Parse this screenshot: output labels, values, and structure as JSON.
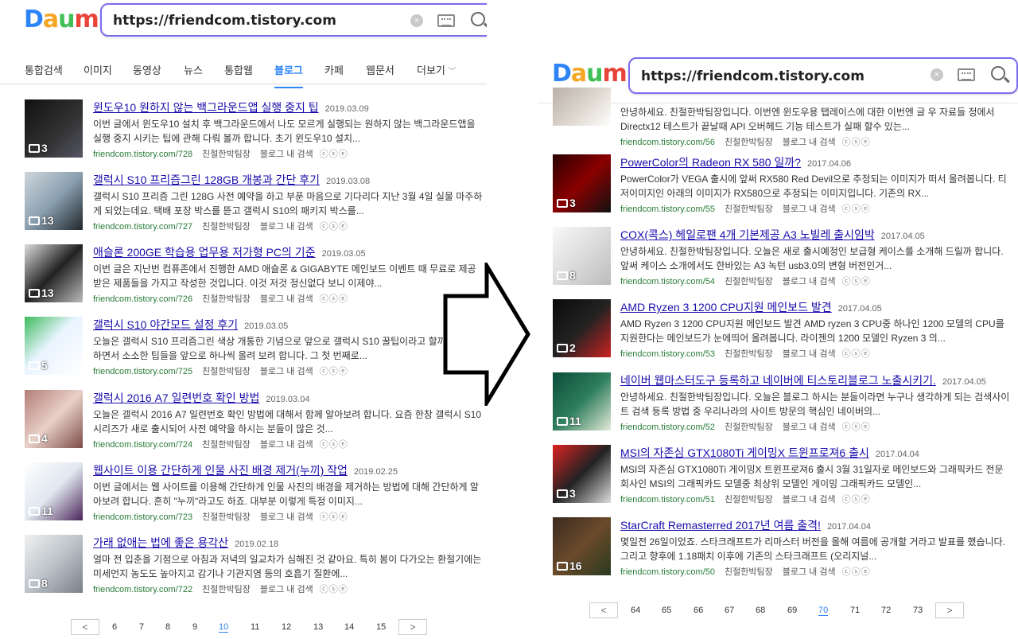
{
  "left": {
    "logo": "Daum",
    "search_url": "https://friendcom.tistory.com",
    "tabs": [
      "통합검색",
      "이미지",
      "동영상",
      "뉴스",
      "통합웹",
      "블로그",
      "카페",
      "웹문서",
      "더보기"
    ],
    "results": [
      {
        "title": "윈도우10 원하지 않는 백그라운드앱 실행 중지 팁",
        "date": "2019.03.09",
        "desc": "이번 글에서 윈도우10 설치 후 백그라운드에서 나도 모르게 실행되는 원하지 않는 백그라운드앱을 실행 중지 시키는 팁에 관해 다뤄 볼까 합니다. 초기 윈도우10 설치...",
        "url": "friendcom.tistory.com/728",
        "author": "친절한박팀장",
        "count": "3"
      },
      {
        "title": "갤럭시 S10 프리즘그린 128GB 개봉과 간단 후기",
        "date": "2019.03.08",
        "desc": "갤럭시 S10 프리즘 그린 128G 사전 예약을 하고 부푼 마음으로 기다리다 지난 3월 4일 실물 마주하게 되었는데요. 택배 포장 박스를 뜯고 갤럭시 S10의 패키지 박스를...",
        "url": "friendcom.tistory.com/727",
        "author": "친절한박팀장",
        "count": "13"
      },
      {
        "title": "애슬론 200GE 학습용 업무용 저가형 PC의 기준",
        "date": "2019.03.05",
        "desc": "이번 글은 지난번 컴퓨존에서 진행한 AMD 애슬론 & GIGABYTE 메인보드 이벤트 때 무료로 제공받은 제품들을 가지고 작성한 것입니다. 이것 저것 정신없다 보니 이제야...",
        "url": "friendcom.tistory.com/726",
        "author": "친절한박팀장",
        "count": "13"
      },
      {
        "title": "갤럭시 S10 야간모드 설정 후기",
        "date": "2019.03.05",
        "desc": "오늘은 갤럭시 S10 프리즘그린 색상 개통한 기념으로 앞으로 갤럭시 S10 꿀팁이라고 할까요? 사용하면서 소소한 팁들을 앞으로 하나씩 올려 보려 합니다. 그 첫 번째로...",
        "url": "friendcom.tistory.com/725",
        "author": "친절한박팀장",
        "count": "5"
      },
      {
        "title": "갤럭시 2016 A7 일련번호 확인 방법",
        "date": "2019.03.04",
        "desc": "오늘은 갤럭시 2016 A7 일련번호 확인 방법에 대해서 함께 알아보려 합니다. 요즘 한창 갤럭시 S10 시리즈가 새로 출시되어 사전 예약을 하시는 분들이 많은 것...",
        "url": "friendcom.tistory.com/724",
        "author": "친절한박팀장",
        "count": "4"
      },
      {
        "title": "웹사이트 이용 간단하게 인물 사진 배경 제거(누끼) 작업",
        "date": "2019.02.25",
        "desc": "이번 글에서는 웹 사이트를 이용해 간단하게 인물 사진의 배경을 제거하는 방법에 대해 간단하게 알아보려 합니다. 흔히 \"누끼\"라고도 하죠. 대부분 이렇게 특정 이미지...",
        "url": "friendcom.tistory.com/723",
        "author": "친절한박팀장",
        "count": "11"
      },
      {
        "title": "가래 없애는 법에 좋은 용각산",
        "date": "2019.02.18",
        "desc": "얼마 전 입춘을 기점으로 아침과 저녁의 일교차가 심해진 것 같아요. 특히 봄이 다가오는 환절기에는 미세먼지 농도도 높아지고 감기나 기관지염 등의 호흡기 질환에...",
        "url": "friendcom.tistory.com/722",
        "author": "친절한박팀장",
        "count": "8"
      }
    ],
    "meta_label": "블로그 내 검색",
    "pages": [
      "6",
      "7",
      "8",
      "9",
      "10",
      "11",
      "12",
      "13",
      "14",
      "15"
    ],
    "current_page": "10",
    "prev": "<",
    "next": ">"
  },
  "right": {
    "logo": "Daum",
    "search_url": "https://friendcom.tistory.com",
    "partial": {
      "desc": "안녕하세요. 친절한박팀장입니다. 이번엔 윈도우용 탭레이스에 대한 이번엔 글 우 자료들 정에서 Directx12 테스트가 끝날때 API 오버헤드 기능 테스트가 실패 할수 있는...",
      "url": "friendcom.tistory.com/56",
      "author": "친절한박팀장"
    },
    "results": [
      {
        "title": "PowerColor의 Radeon RX 580 일까?",
        "date": "2017.04.06",
        "desc": "PowerColor가 VEGA 출시에 앞써 RX580 Red Devil으로 추정되는 이미지가 떠서 올려봅니다. 티저이미지인 아래의 이미지가 RX580으로 추정되는 이미지입니다. 기존의 RX...",
        "url": "friendcom.tistory.com/55",
        "author": "친절한박팀장",
        "count": "3"
      },
      {
        "title": "COX(콕스) 헤일로팬 4개 기본제공 A3 노빌레 출시임박",
        "date": "2017.04.05",
        "desc": "안녕하세요. 친절한박팀장입니다. 오늘은 새로 출시예정인 보급형 케이스를 소개해 드릴까 합니다. 앞써 케이스 소개에서도 한바있는 A3 녹턴 usb3.0의 변형 버전인거...",
        "url": "friendcom.tistory.com/54",
        "author": "친절한박팀장",
        "count": "8"
      },
      {
        "title": "AMD Ryzen 3 1200 CPU지원 메인보드 발견",
        "date": "2017.04.05",
        "desc": "AMD Ryzen 3 1200 CPU지원 메인보드 발견 AMD ryzen 3 CPU중 하나인 1200 모델의 CPU를 지원한다는 메인보드가 눈에띄어 올려봅니다. 라이젠의 1200 모델인 Ryzen 3 의...",
        "url": "friendcom.tistory.com/53",
        "author": "친절한박팀장",
        "count": "2"
      },
      {
        "title": "네이버 웹마스터도구 등록하고 네이버에 티스토리블로그 노출시키기.",
        "date": "2017.04.05",
        "desc": "안녕하세요. 친절한박팀장입니다. 오늘은 블로그 하시는 분들이라면 누구나 생각하게 되는 검색사이트 검색 등록 방법 중 우리나라의 사이트 방문의 핵심인 네이버의...",
        "url": "friendcom.tistory.com/52",
        "author": "친절한박팀장",
        "count": "11"
      },
      {
        "title": "MSI의 자존심 GTX1080Ti 게이밍X 트윈프로져6 출시",
        "date": "2017.04.04",
        "desc": "MSI의 자존심 GTX1080Ti 게이밍X 트윈프로져6 출시 3월 31일자로 메인보드와 그래픽카드 전문회사인 MSI의 그래픽카드 모델중 최상위 모델인 게이밍 그래픽카드 모델인...",
        "url": "friendcom.tistory.com/51",
        "author": "친절한박팀장",
        "count": "3"
      },
      {
        "title": "StarCraft Remasterred 2017년 여름 출격!",
        "date": "2017.04.04",
        "desc": "몇일전 26일이었죠. 스타크래프트가 리마스터 버전을 올해 여름에 공개할 거라고 발표를 했습니다. 그리고 향후에 1.18패치 이후에 기존의 스타크래프트 (오리지널...",
        "url": "friendcom.tistory.com/50",
        "author": "친절한박팀장",
        "count": "16"
      }
    ],
    "meta_label": "블로그 내 검색",
    "pages": [
      "64",
      "65",
      "66",
      "67",
      "68",
      "69",
      "70",
      "71",
      "72",
      "73"
    ],
    "current_page": "70",
    "prev": "<",
    "next": ">"
  },
  "colors": {
    "accent": "#2d84f6",
    "link": "#1a0dab",
    "url_green": "#2a7d3a"
  }
}
